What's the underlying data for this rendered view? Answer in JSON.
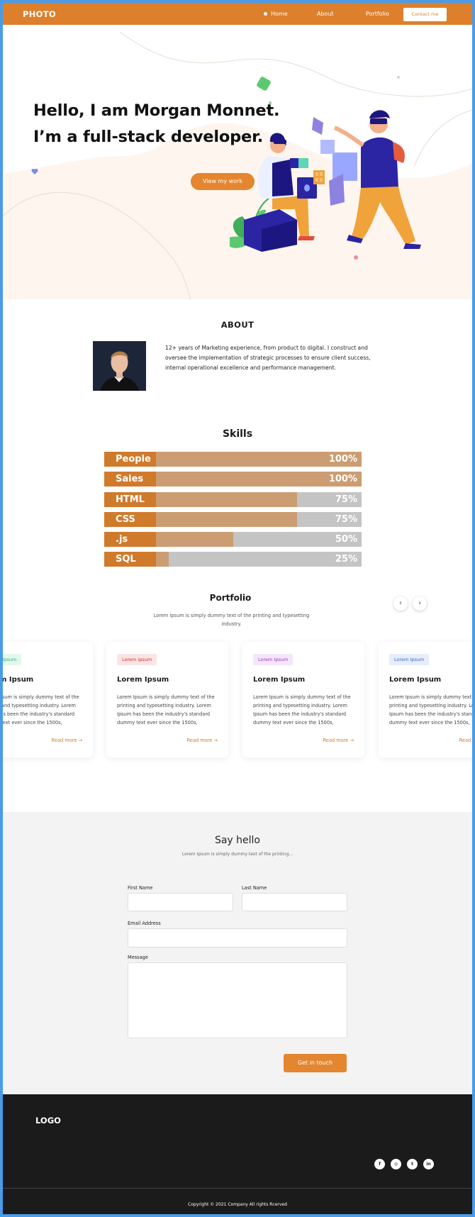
{
  "header": {
    "logo": "PHOTO",
    "nav": [
      "Home",
      "About",
      "Portfolio"
    ],
    "contact_label": "Contact me"
  },
  "hero": {
    "title_line1": "Hello, I am Morgan Monnet.",
    "title_line2": "I’m a full-stack developer.",
    "cta_label": "View my work"
  },
  "about": {
    "heading": "ABOUT",
    "text": "12+ years of Marketing experience, from product to digital. I construct and oversee the implementation of strategic processes to ensure client success, internal operational excellence and performance management."
  },
  "skills": {
    "heading": "Skills",
    "items": [
      {
        "label": "People",
        "pct_label": "100%",
        "level": 1.0
      },
      {
        "label": "Sales",
        "pct_label": "100%",
        "level": 1.0
      },
      {
        "label": "HTML",
        "pct_label": "75%",
        "level": 0.75
      },
      {
        "label": "CSS",
        "pct_label": "75%",
        "level": 0.75
      },
      {
        "label": ".js",
        "pct_label": "50%",
        "level": 0.5
      },
      {
        "label": "SQL",
        "pct_label": "25%",
        "level": 0.25
      }
    ]
  },
  "portfolio": {
    "heading": "Portfolio",
    "subtitle": "Lorem Ipsum is simply dummy text of the printing and typesetting industry.",
    "prev_icon": "‹",
    "next_icon": "›",
    "cards": [
      {
        "tag": "Lorem Ipsum",
        "tag_color": "#2fb36b",
        "tag_bg": "#e4f7ec",
        "title": "Lorem Ipsum",
        "text": "Lorem Ipsum is simply dummy text of the printing and typesetting industry. Lorem Ipsum has been the industry's standard dummy text ever since the 1500s,",
        "read_more": "Read more"
      },
      {
        "tag": "Lorem ipsum",
        "tag_color": "#c62b2b",
        "tag_bg": "#fbe5e4",
        "title": "Lorem Ipsum",
        "text": "Lorem Ipsum is simply dummy text of the printing and typesetting industry. Lorem Ipsum has been the industry's standard dummy text ever since the 1500s,",
        "read_more": "Read more"
      },
      {
        "tag": "Lorem Ipsum",
        "tag_color": "#9b2fc7",
        "tag_bg": "#f4e6fb",
        "title": "Lorem Ipsum",
        "text": "Lorem Ipsum is simply dummy text of the printing and typesetting industry. Lorem Ipsum has been the industry's standard dummy text ever since the 1500s,",
        "read_more": "Read more"
      },
      {
        "tag": "Lorem Ipsum",
        "tag_color": "#3a62c9",
        "tag_bg": "#e6edfb",
        "title": "Lorem Ipsum",
        "text": "Lorem Ipsum is simply dummy text of the printing and typesetting industry. Lorem Ipsum has been the industry's standard dummy text ever since the 1500s,",
        "read_more": "Read more"
      }
    ]
  },
  "contact": {
    "heading": "Say hello",
    "subtitle": "Lorem Ipsum is simply dummy text of the printing...",
    "first_name_label": "First Name",
    "last_name_label": "Last Name",
    "email_label": "Email Address",
    "message_label": "Message",
    "submit_label": "Get in touch"
  },
  "footer": {
    "logo": "LOGO",
    "socials": [
      {
        "icon": "facebook-icon",
        "glyph": "f"
      },
      {
        "icon": "instagram-icon",
        "glyph": "◎"
      },
      {
        "icon": "twitter-icon",
        "glyph": "t"
      },
      {
        "icon": "linkedin-icon",
        "glyph": "in"
      }
    ],
    "copyright": "Copyright © 2021 Company All rights Rcerved"
  },
  "colors": {
    "accent": "#dd7f2b",
    "skill_label": "#d07a2c",
    "skill_fill": "#cc9d72",
    "skill_track": "#c4c4c4",
    "footer_bg": "#1b1b1b"
  }
}
